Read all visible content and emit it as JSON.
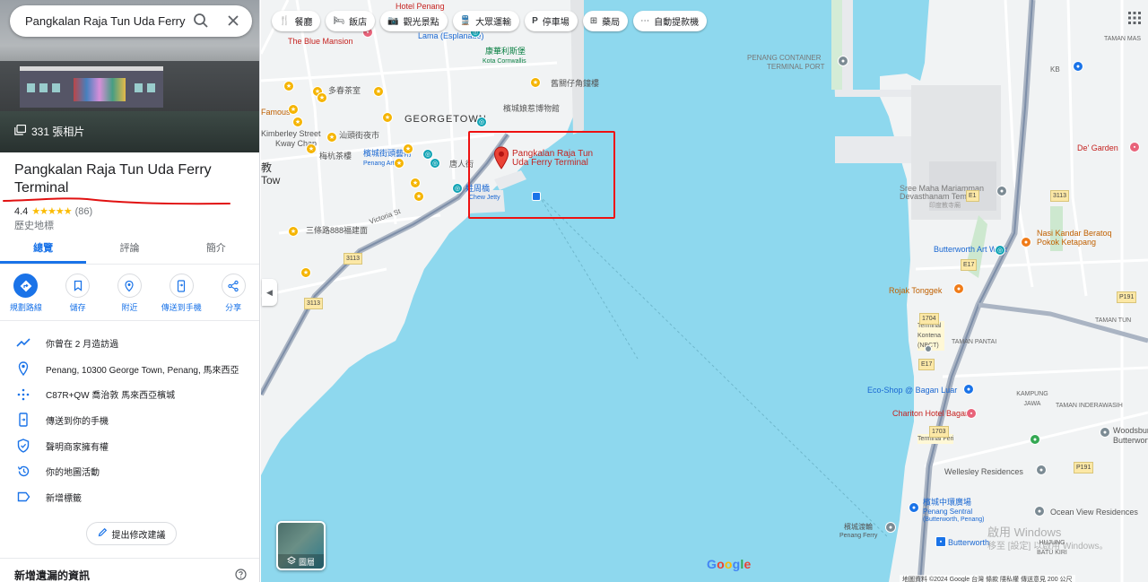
{
  "search": {
    "value": "Pangkalan Raja Tun Uda Ferry Terminal"
  },
  "hero": {
    "photo_count": "331 張相片"
  },
  "place": {
    "name": "Pangkalan Raja Tun Uda Ferry Terminal",
    "rating": "4.4",
    "stars": "★★★★★",
    "review_count": "(86)",
    "category": "歷史地標"
  },
  "tabs": [
    {
      "label": "總覽",
      "active": true
    },
    {
      "label": "評論",
      "active": false
    },
    {
      "label": "簡介",
      "active": false
    }
  ],
  "actions": [
    {
      "label": "規劃路線",
      "icon": "directions-icon"
    },
    {
      "label": "儲存",
      "icon": "bookmark-icon"
    },
    {
      "label": "附近",
      "icon": "nearby-icon"
    },
    {
      "label": "傳送到手機",
      "icon": "send-to-phone-icon"
    },
    {
      "label": "分享",
      "icon": "share-icon"
    }
  ],
  "info": [
    {
      "text": "你曾在 2 月造訪過",
      "icon": "trending-icon"
    },
    {
      "text": "Penang, 10300 George Town, Penang, 馬來西亞",
      "icon": "location-pin-icon"
    },
    {
      "text": "C87R+QW 喬治敦 馬來西亞檳城",
      "icon": "plus-code-icon"
    },
    {
      "text": "傳送到你的手機",
      "icon": "phone-icon"
    },
    {
      "text": "聲明商家擁有權",
      "icon": "shield-icon"
    },
    {
      "text": "你的地圖活動",
      "icon": "history-icon"
    },
    {
      "text": "新增標籤",
      "icon": "label-icon"
    }
  ],
  "suggest_edit": "提出修改建議",
  "add_missing": "新增遺漏的資訊",
  "chips": [
    {
      "label": "餐廳",
      "icon": "restaurant-icon",
      "glyph": "🍴"
    },
    {
      "label": "飯店",
      "icon": "hotel-icon",
      "glyph": "🛏"
    },
    {
      "label": "觀光景點",
      "icon": "camera-icon",
      "glyph": "📷"
    },
    {
      "label": "大眾運輸",
      "icon": "transit-icon",
      "glyph": "🚆"
    },
    {
      "label": "停車場",
      "icon": "parking-icon",
      "glyph": "P"
    },
    {
      "label": "藥局",
      "icon": "pharmacy-icon",
      "glyph": "⊞"
    },
    {
      "label": "自動提款機",
      "icon": "atm-icon",
      "glyph": "⋯"
    }
  ],
  "map": {
    "marker_label": "Pangkalan Raja Tun Uda Ferry Terminal",
    "layers_label": "圖層",
    "google": "Google",
    "footer": "地圖資料 ©2024 Google   台灣   條款   隱私權   傳送意見   200 公尺",
    "watermark_line1": "啟用 Windows",
    "watermark_line2": "移至 [設定] 以啟用 Windows。",
    "labels": {
      "hotel_penang": "Hotel Penang",
      "blue_mansion": "The Blue Mansion",
      "lama": "Lama (Esplanade)",
      "kota": "Kota Cornwallis",
      "kota_cn": "康華利斯堡",
      "clock": "舊關仔角鐘樓",
      "museum_cn": "檳城娘惹博物館",
      "georgetown": "GEORGETOWN",
      "cafe": "多春茶室",
      "kimberley": "Kimberley Street",
      "kway": "Kway Chap",
      "famous": "Famous",
      "shantou": "汕頭街夜市",
      "tea": "梅杭茶樓",
      "penang_art": "檳城街頭藝術",
      "penang_art2": "Penang Art",
      "tanghen": "唐人街",
      "jetty_cn": "姓周橋",
      "jetty": "Chew Jetty",
      "victoria": "Victoria St",
      "sanlu": "三條路888福建面",
      "town": "Tow",
      "jiao": "教",
      "container": "PENANG CONTAINER",
      "container2": "TERMINAL PORT",
      "sree": "Sree Maha Mariamman",
      "sree2": "Devasthanam Temple",
      "sree3": "印度教寺廟",
      "degarden": "De' Garden",
      "nasi": "Nasi Kandar Beratoq",
      "nasi2": "Pokok Ketapang",
      "butterworth_art": "Butterworth Art Walk",
      "rojak": "Rojak Tonggek",
      "terminal_kontena": "Terminal Kontena (NBCT)",
      "taman_pantai": "TAMAN PANTAI",
      "taman_tun": "TAMAN TUN",
      "ecoshop": "Eco-Shop @ Bagan Luar",
      "kampung": "KAMPUNG JAWA",
      "chariton": "Chariton Hotel Bagan",
      "terminal_feri": "Terminal Feri",
      "taman_inderawasih": "TAMAN INDERAWASIH",
      "woodsbury": "Woodsbury",
      "butterworth": "Butterworth",
      "wellesley": "Wellesley Residences",
      "penang_sentral": "檳城中環廣場",
      "penang_sentral2": "Penang Sentral",
      "penang_sentral3": "(Butterworth, Penang)",
      "ocean_view": "Ocean View Residences",
      "ferry_cn": "檳城渡輪",
      "ferry_en": "Penang Ferry",
      "butterworth_station": "Butterworth",
      "hujung": "HUJUNG BATU KIRI",
      "tamanmas": "TAMAN MAS",
      "kb": "KB",
      "e17": "E17",
      "e1": "E1",
      "f3113": "3113",
      "p191": "P191",
      "p1": "1704",
      "p2": "1703"
    }
  },
  "colors": {
    "accent": "#1a73e8",
    "sea": "#8ed8ee",
    "land": "#f1f3f4",
    "annotation": "#e11111",
    "marker": "#ea4335"
  }
}
